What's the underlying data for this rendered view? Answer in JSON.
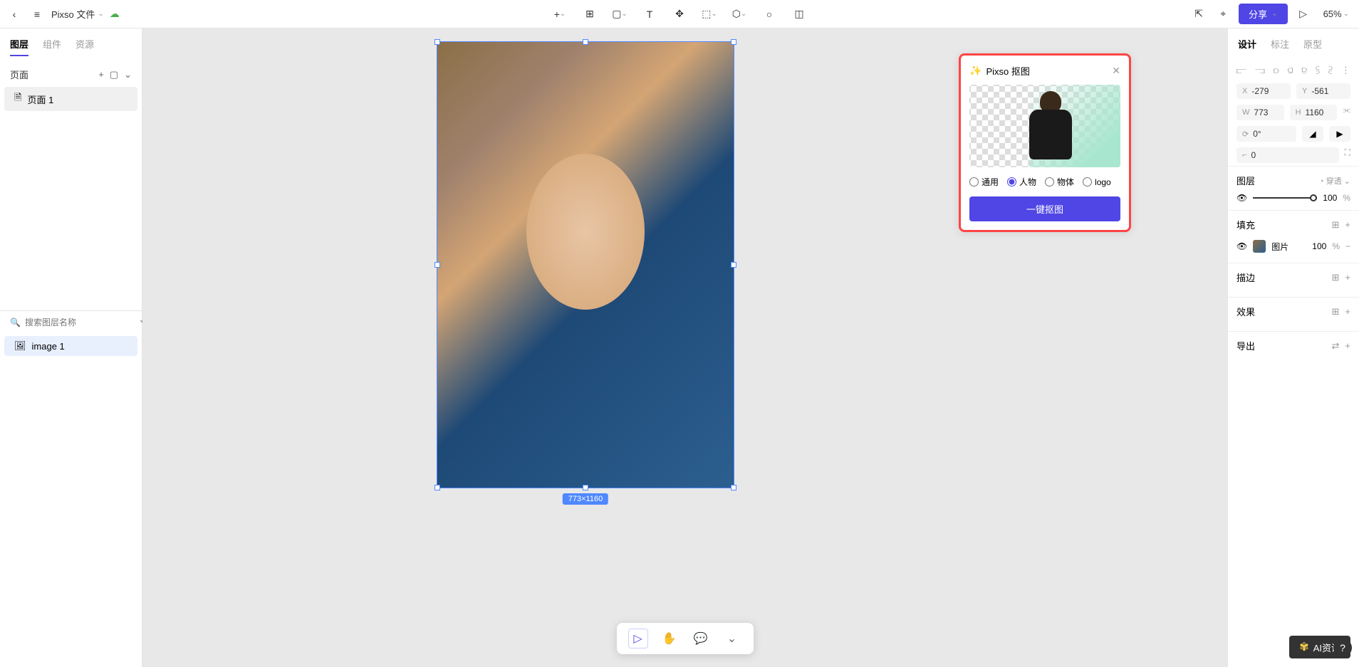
{
  "topbar": {
    "file_name": "Pixso 文件",
    "share_label": "分享",
    "zoom": "65%"
  },
  "left_panel": {
    "tabs": [
      "图层",
      "组件",
      "资源"
    ],
    "pages_label": "页面",
    "pages": [
      "页面 1"
    ],
    "search_placeholder": "搜索图层名称",
    "layers": [
      "image 1"
    ]
  },
  "canvas": {
    "selection_dimensions": "773×1160"
  },
  "cutout_panel": {
    "title": "Pixso 抠图",
    "options": [
      "通用",
      "人物",
      "物体",
      "logo"
    ],
    "selected_option": "人物",
    "button_label": "一键抠图"
  },
  "right_panel": {
    "tabs": [
      "设计",
      "标注",
      "原型"
    ],
    "x_label": "X",
    "x_value": "-279",
    "y_label": "Y",
    "y_value": "-561",
    "w_label": "W",
    "w_value": "773",
    "h_label": "H",
    "h_value": "1160",
    "rotation_value": "0°",
    "corner_value": "0",
    "layer_section": "图层",
    "passthrough": "穿透",
    "opacity_value": "100",
    "percent": "%",
    "fill_section": "填充",
    "fill_type": "图片",
    "fill_opacity": "100",
    "stroke_section": "描边",
    "effects_section": "效果",
    "export_section": "导出"
  },
  "ai_badge": "AI资讯"
}
